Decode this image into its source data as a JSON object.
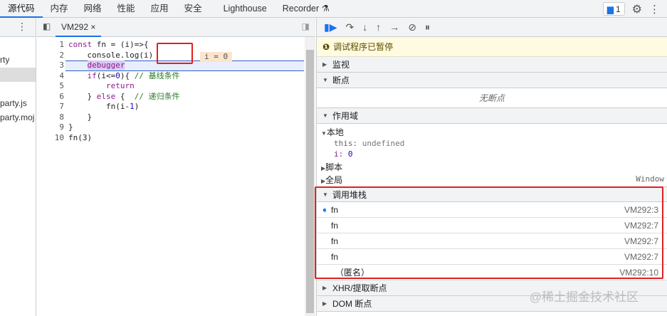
{
  "tabs": [
    "源代码",
    "内存",
    "网络",
    "性能",
    "应用",
    "安全",
    "Lighthouse",
    "Recorder ⚗"
  ],
  "issues_count": "1",
  "navigator": {
    "files": [
      "rty",
      "party.js",
      "party.moj"
    ]
  },
  "editor": {
    "file_tab": "VM292",
    "close": "×",
    "lines": [
      {
        "n": "1",
        "html": "<span class=\"kw\">const</span> fn = (i)=>{"
      },
      {
        "n": "2",
        "html": "    console.log(i)"
      },
      {
        "n": "3",
        "html": "    <span class=\"kw\" style=\"background:#d9c8f5\">debugger</span>"
      },
      {
        "n": "4",
        "html": "    <span class=\"kw\">if</span>(i<=<span class=\"num\">0</span>){ <span class=\"cm\">// 基线条件</span>"
      },
      {
        "n": "5",
        "html": "        <span class=\"kw\">return</span>"
      },
      {
        "n": "6",
        "html": "    } <span class=\"kw\">else</span> {  <span class=\"cm\">// 递归条件</span>"
      },
      {
        "n": "7",
        "html": "        fn(i-<span class=\"num\">1</span>)"
      },
      {
        "n": "8",
        "html": "    }"
      },
      {
        "n": "9",
        "html": "}"
      },
      {
        "n": "10",
        "html": "fn(3)"
      }
    ],
    "inline_value": "i = 0"
  },
  "debugger": {
    "paused": "调试程序已暂停",
    "watch": "监视",
    "breakpoints": "断点",
    "no_breakpoints": "无断点",
    "scope": "作用域",
    "local": "本地",
    "this_label": "this:",
    "this_value": "undefined",
    "i_label": "i:",
    "i_value": "0",
    "script": "脚本",
    "global": "全局",
    "global_value": "Window",
    "call_stack": "调用堆栈",
    "frames": [
      {
        "name": "fn",
        "loc": "VM292:3"
      },
      {
        "name": "fn",
        "loc": "VM292:7"
      },
      {
        "name": "fn",
        "loc": "VM292:7"
      },
      {
        "name": "fn",
        "loc": "VM292:7"
      },
      {
        "name": "（匿名）",
        "loc": "VM292:10"
      }
    ],
    "xhr": "XHR/提取断点",
    "dom": "DOM 断点"
  },
  "watermark": "@稀土掘金技术社区",
  "colors": {
    "accent": "#1a73e8",
    "highlight": "#e02020"
  }
}
